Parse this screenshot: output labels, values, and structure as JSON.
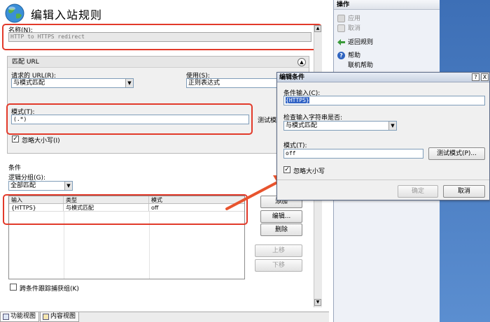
{
  "window": {
    "title": "编辑入站规则"
  },
  "name_section": {
    "label": "名称(N):",
    "value": "HTTP to HTTPS redirect"
  },
  "match_url": {
    "header": "匹配 URL",
    "requested_url_label": "请求的 URL(R):",
    "requested_url_value": "与模式匹配",
    "using_label": "使用(S):",
    "using_value": "正则表达式",
    "pattern_label": "模式(T):",
    "pattern_value": "(.*)",
    "test_label": "测试模",
    "ignore_case_label": "忽略大小写(I)",
    "ignore_case_checked": "✓"
  },
  "conditions": {
    "header": "条件",
    "logical_group_label": "逻辑分组(G):",
    "logical_group_value": "全部匹配",
    "columns": [
      "输入",
      "类型",
      "模式"
    ],
    "rows": [
      {
        "input": "{HTTPS}",
        "type": "与模式匹配",
        "pattern": "off"
      }
    ],
    "buttons": {
      "add": "添加",
      "edit": "编辑...",
      "remove": "删除",
      "up": "上移",
      "down": "下移"
    },
    "track_label": "跨条件跟踪捕获组(K)"
  },
  "actions_pane": {
    "title": "操作",
    "apply": "应用",
    "cancel": "取消",
    "back": "返回规则",
    "help": "帮助",
    "online_help": "联机帮助"
  },
  "dialog": {
    "title": "编辑条件",
    "help_glyph": "?",
    "close_glyph": "X",
    "condition_input_label": "条件输入(C):",
    "condition_input_value": "{HTTPS}",
    "check_label": "检查输入字符串是否:",
    "check_value": "与模式匹配",
    "pattern_label": "模式(T):",
    "pattern_value": "off",
    "test_button": "测试模式(P)...",
    "ignore_case_label": "忽略大小写",
    "ignore_case_checked": "✓",
    "ok": "确定",
    "cancel": "取消"
  },
  "bottom_tabs": {
    "features": "功能视图",
    "content": "内容视图"
  },
  "colors": {
    "highlight_red": "#e23a2a",
    "blue_bar": "#4a7fc4",
    "dialog_title_bg": "#c9d3e3"
  },
  "icons": [
    "globe-icon",
    "apply-icon",
    "cancel-icon",
    "back-arrow-icon",
    "help-icon",
    "features-view-icon",
    "content-view-icon"
  ]
}
